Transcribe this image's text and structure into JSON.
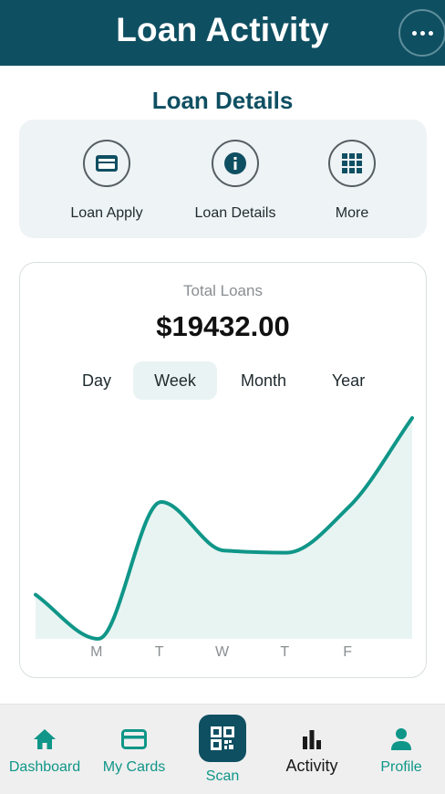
{
  "header": {
    "title": "Loan Activity",
    "menu_icon": "more-horizontal-icon"
  },
  "section_title": "Loan Details",
  "actions": [
    {
      "label": "Loan Apply",
      "icon": "credit-card-icon"
    },
    {
      "label": "Loan Details",
      "icon": "info-icon"
    },
    {
      "label": "More",
      "icon": "grid-icon"
    }
  ],
  "summary": {
    "total_label": "Total Loans",
    "total_amount": "$19432.00"
  },
  "periods": [
    {
      "label": "Day",
      "active": false
    },
    {
      "label": "Week",
      "active": true
    },
    {
      "label": "Month",
      "active": false
    },
    {
      "label": "Year",
      "active": false
    }
  ],
  "chart_data": {
    "type": "area",
    "categories": [
      "M",
      "T",
      "W",
      "T",
      "F"
    ],
    "x": [
      0,
      1,
      2,
      3,
      4,
      5,
      6
    ],
    "values": [
      20,
      0,
      62,
      40,
      39,
      60,
      100
    ],
    "ylim": [
      0,
      100
    ],
    "title": "",
    "xlabel": "",
    "ylabel": "",
    "line_color": "#0f9688",
    "fill_color": "#e8f4f2",
    "grid": false,
    "legend": "none"
  },
  "bottom_nav": [
    {
      "label": "Dashboard",
      "icon": "home-icon",
      "active": false
    },
    {
      "label": "My Cards",
      "icon": "credit-card-icon",
      "active": false
    },
    {
      "label": "Scan",
      "icon": "qr-code-icon",
      "active": false
    },
    {
      "label": "Activity",
      "icon": "bar-chart-icon",
      "active": true
    },
    {
      "label": "Profile",
      "icon": "person-icon",
      "active": false
    }
  ],
  "colors": {
    "primary": "#0f4f62",
    "accent": "#0f9688",
    "panel": "#eef3f6"
  }
}
